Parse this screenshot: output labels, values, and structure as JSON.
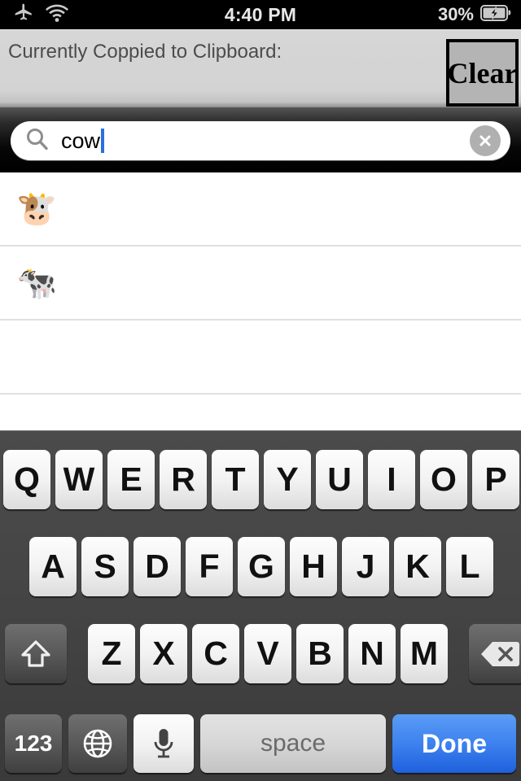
{
  "statusbar": {
    "airplane_icon": "airplane-mode-icon",
    "wifi_icon": "wifi-icon",
    "time": "4:40 PM",
    "battery_percent": "30%",
    "battery_icon": "battery-charging-icon"
  },
  "clipboard": {
    "label": "Currently Coppied to Clipboard:",
    "value": "",
    "clear_label": "Clear",
    "bg_color": "#d3d3d3",
    "clear_bg_color": "#b4b4b4"
  },
  "search": {
    "value": "cow",
    "placeholder": "Search",
    "search_icon": "search-icon",
    "clear_icon": "clear-circle-icon",
    "caret_color": "#2b6fe0"
  },
  "results": {
    "rows": [
      {
        "emoji": "🐮",
        "name": "cow-face-emoji"
      },
      {
        "emoji": "🐄",
        "name": "cow-emoji"
      },
      {
        "emoji": "",
        "name": "empty-row"
      },
      {
        "emoji": "",
        "name": "empty-row"
      }
    ]
  },
  "keyboard": {
    "row1": [
      "Q",
      "W",
      "E",
      "R",
      "T",
      "Y",
      "U",
      "I",
      "O",
      "P"
    ],
    "row2": [
      "A",
      "S",
      "D",
      "F",
      "G",
      "H",
      "J",
      "K",
      "L"
    ],
    "row3": [
      "Z",
      "X",
      "C",
      "V",
      "B",
      "N",
      "M"
    ],
    "shift_icon": "shift-icon",
    "backspace_icon": "backspace-icon",
    "numbers_label": "123",
    "globe_icon": "globe-icon",
    "microphone_icon": "microphone-icon",
    "space_label": "space",
    "done_label": "Done",
    "done_color": "#3d82ef"
  }
}
